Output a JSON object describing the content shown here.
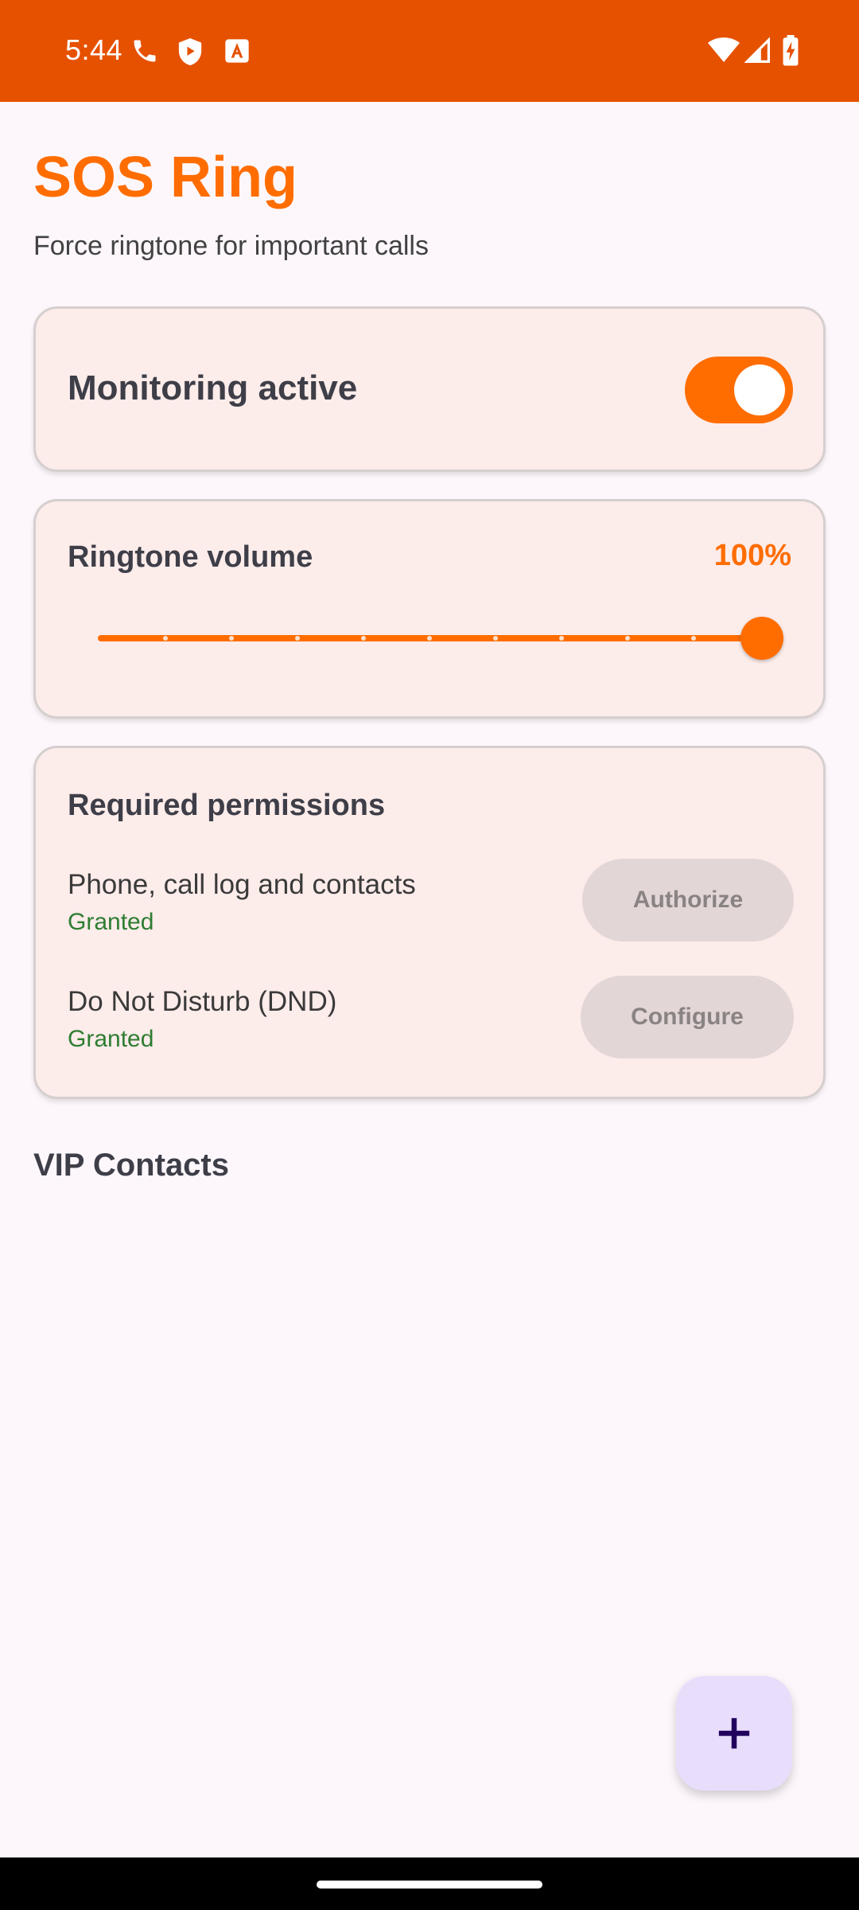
{
  "status_bar": {
    "time": "5:44",
    "icons_left": [
      "phone-icon",
      "shield-play-icon",
      "font-a-icon"
    ],
    "icons_right": [
      "wifi-icon",
      "cell-signal-icon",
      "battery-charging-icon"
    ]
  },
  "app": {
    "title": "SOS Ring",
    "subtitle": "Force ringtone for important calls",
    "accent_color": "#ff6d00"
  },
  "monitoring": {
    "label": "Monitoring active",
    "enabled": true
  },
  "volume": {
    "label": "Ringtone volume",
    "value_text": "100%",
    "value": 1.0,
    "steps": 10
  },
  "permissions": {
    "heading": "Required permissions",
    "items": [
      {
        "name": "Phone, call log and contacts",
        "status": "Granted",
        "button": "Authorize",
        "button_enabled": false
      },
      {
        "name": "Do Not Disturb (DND)",
        "status": "Granted",
        "button": "Configure",
        "button_enabled": false
      }
    ]
  },
  "vip": {
    "heading": "VIP Contacts"
  },
  "fab": {
    "icon": "plus-icon"
  }
}
